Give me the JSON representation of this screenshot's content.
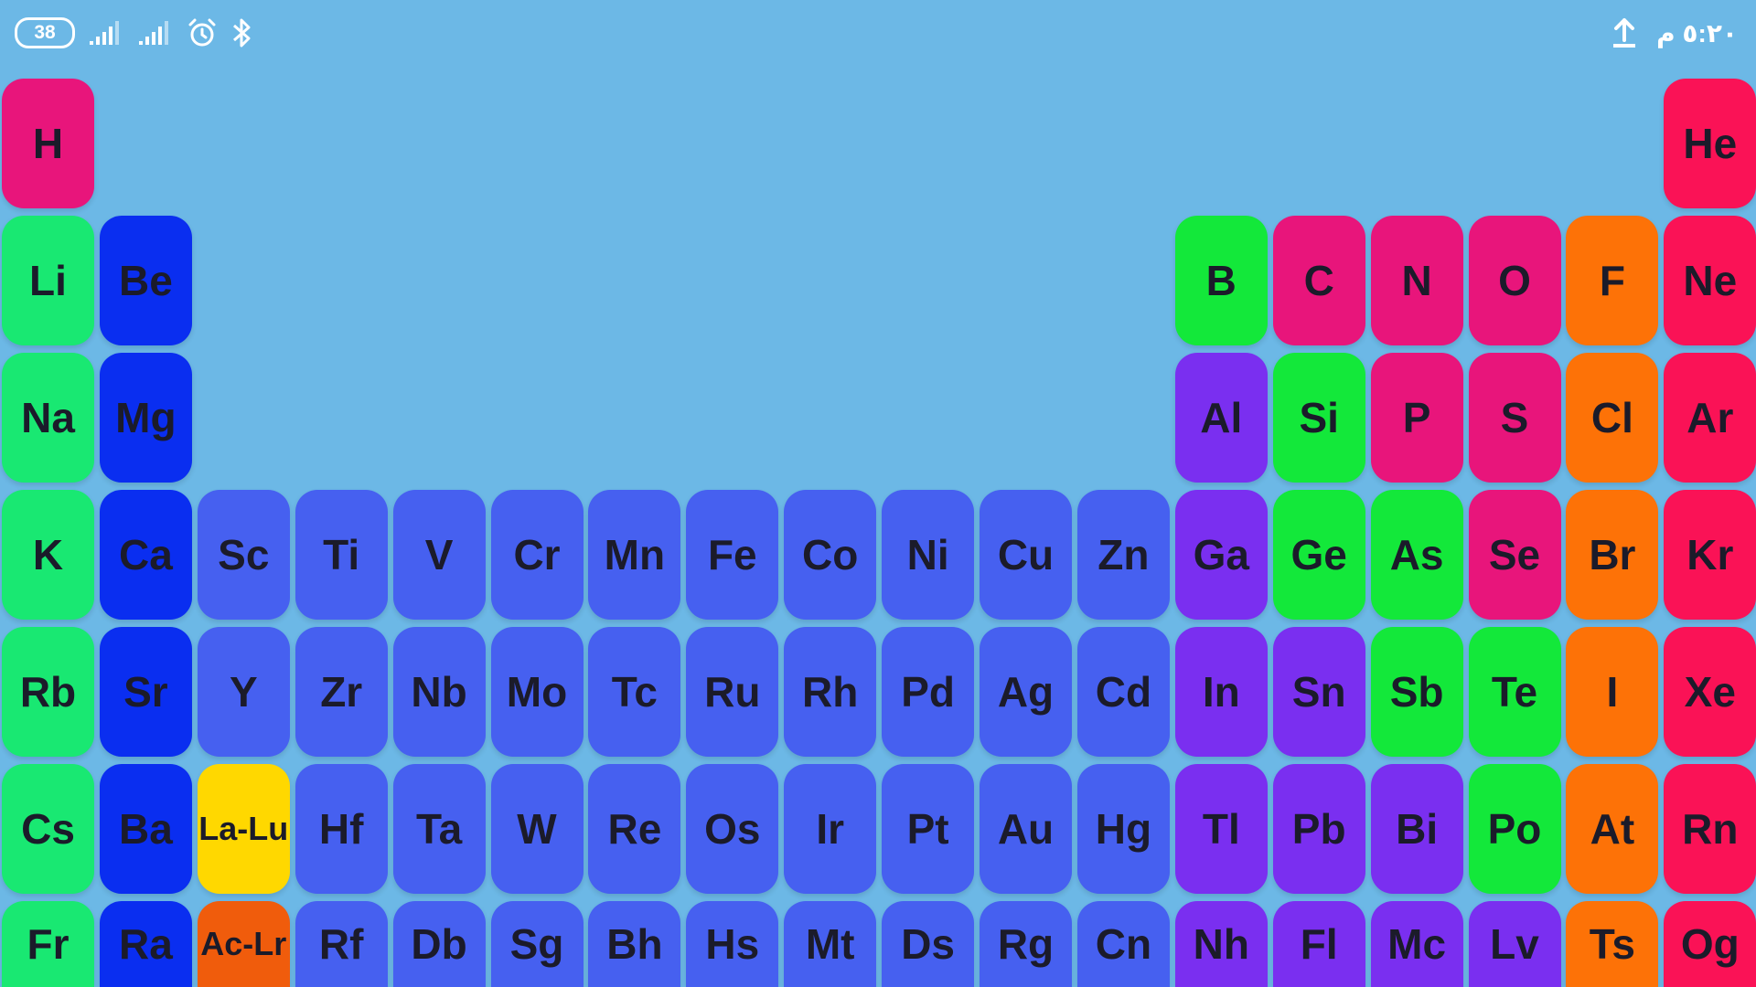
{
  "status_bar": {
    "battery": "38",
    "time": "٥:٢٠ م",
    "icons": [
      "signal-icon",
      "signal-icon",
      "alarm-icon",
      "bluetooth-icon",
      "upload-icon"
    ]
  },
  "colors": {
    "background": "#6cb8e6",
    "alkali_metal": "#19e872",
    "alkaline_earth": "#0a2ef0",
    "transition_metal": "#4660f0",
    "post_transition": "#7a2ff0",
    "metalloid": "#13e83a",
    "nonmetal": "#e8157b",
    "halogen": "#fd7207",
    "noble_gas": "#fa1256",
    "lanthanide": "#ffd800",
    "actinide": "#f05c0c"
  },
  "table": {
    "rows": [
      [
        {
          "s": "H",
          "t": "nonmetal"
        },
        {
          "s": "He",
          "t": "noble_gas"
        }
      ],
      [
        {
          "s": "Li",
          "t": "alkali_metal"
        },
        {
          "s": "Be",
          "t": "alkaline_earth"
        },
        {
          "s": "B",
          "t": "metalloid"
        },
        {
          "s": "C",
          "t": "nonmetal"
        },
        {
          "s": "N",
          "t": "nonmetal"
        },
        {
          "s": "O",
          "t": "nonmetal"
        },
        {
          "s": "F",
          "t": "halogen"
        },
        {
          "s": "Ne",
          "t": "noble_gas"
        }
      ],
      [
        {
          "s": "Na",
          "t": "alkali_metal"
        },
        {
          "s": "Mg",
          "t": "alkaline_earth"
        },
        {
          "s": "Al",
          "t": "post_transition"
        },
        {
          "s": "Si",
          "t": "metalloid"
        },
        {
          "s": "P",
          "t": "nonmetal"
        },
        {
          "s": "S",
          "t": "nonmetal"
        },
        {
          "s": "Cl",
          "t": "halogen"
        },
        {
          "s": "Ar",
          "t": "noble_gas"
        }
      ],
      [
        {
          "s": "K",
          "t": "alkali_metal"
        },
        {
          "s": "Ca",
          "t": "alkaline_earth"
        },
        {
          "s": "Sc",
          "t": "transition_metal"
        },
        {
          "s": "Ti",
          "t": "transition_metal"
        },
        {
          "s": "V",
          "t": "transition_metal"
        },
        {
          "s": "Cr",
          "t": "transition_metal"
        },
        {
          "s": "Mn",
          "t": "transition_metal"
        },
        {
          "s": "Fe",
          "t": "transition_metal"
        },
        {
          "s": "Co",
          "t": "transition_metal"
        },
        {
          "s": "Ni",
          "t": "transition_metal"
        },
        {
          "s": "Cu",
          "t": "transition_metal"
        },
        {
          "s": "Zn",
          "t": "transition_metal"
        },
        {
          "s": "Ga",
          "t": "post_transition"
        },
        {
          "s": "Ge",
          "t": "metalloid"
        },
        {
          "s": "As",
          "t": "metalloid"
        },
        {
          "s": "Se",
          "t": "nonmetal"
        },
        {
          "s": "Br",
          "t": "halogen"
        },
        {
          "s": "Kr",
          "t": "noble_gas"
        }
      ],
      [
        {
          "s": "Rb",
          "t": "alkali_metal"
        },
        {
          "s": "Sr",
          "t": "alkaline_earth"
        },
        {
          "s": "Y",
          "t": "transition_metal"
        },
        {
          "s": "Zr",
          "t": "transition_metal"
        },
        {
          "s": "Nb",
          "t": "transition_metal"
        },
        {
          "s": "Mo",
          "t": "transition_metal"
        },
        {
          "s": "Tc",
          "t": "transition_metal"
        },
        {
          "s": "Ru",
          "t": "transition_metal"
        },
        {
          "s": "Rh",
          "t": "transition_metal"
        },
        {
          "s": "Pd",
          "t": "transition_metal"
        },
        {
          "s": "Ag",
          "t": "transition_metal"
        },
        {
          "s": "Cd",
          "t": "transition_metal"
        },
        {
          "s": "In",
          "t": "post_transition"
        },
        {
          "s": "Sn",
          "t": "post_transition"
        },
        {
          "s": "Sb",
          "t": "metalloid"
        },
        {
          "s": "Te",
          "t": "metalloid"
        },
        {
          "s": "I",
          "t": "halogen"
        },
        {
          "s": "Xe",
          "t": "noble_gas"
        }
      ],
      [
        {
          "s": "Cs",
          "t": "alkali_metal"
        },
        {
          "s": "Ba",
          "t": "alkaline_earth"
        },
        {
          "s": "La-Lu",
          "t": "lanthanide"
        },
        {
          "s": "Hf",
          "t": "transition_metal"
        },
        {
          "s": "Ta",
          "t": "transition_metal"
        },
        {
          "s": "W",
          "t": "transition_metal"
        },
        {
          "s": "Re",
          "t": "transition_metal"
        },
        {
          "s": "Os",
          "t": "transition_metal"
        },
        {
          "s": "Ir",
          "t": "transition_metal"
        },
        {
          "s": "Pt",
          "t": "transition_metal"
        },
        {
          "s": "Au",
          "t": "transition_metal"
        },
        {
          "s": "Hg",
          "t": "transition_metal"
        },
        {
          "s": "Tl",
          "t": "post_transition"
        },
        {
          "s": "Pb",
          "t": "post_transition"
        },
        {
          "s": "Bi",
          "t": "post_transition"
        },
        {
          "s": "Po",
          "t": "metalloid"
        },
        {
          "s": "At",
          "t": "halogen"
        },
        {
          "s": "Rn",
          "t": "noble_gas"
        }
      ],
      [
        {
          "s": "Fr",
          "t": "alkali_metal"
        },
        {
          "s": "Ra",
          "t": "alkaline_earth"
        },
        {
          "s": "Ac-Lr",
          "t": "actinide"
        },
        {
          "s": "Rf",
          "t": "transition_metal"
        },
        {
          "s": "Db",
          "t": "transition_metal"
        },
        {
          "s": "Sg",
          "t": "transition_metal"
        },
        {
          "s": "Bh",
          "t": "transition_metal"
        },
        {
          "s": "Hs",
          "t": "transition_metal"
        },
        {
          "s": "Mt",
          "t": "transition_metal"
        },
        {
          "s": "Ds",
          "t": "transition_metal"
        },
        {
          "s": "Rg",
          "t": "transition_metal"
        },
        {
          "s": "Cn",
          "t": "transition_metal"
        },
        {
          "s": "Nh",
          "t": "post_transition"
        },
        {
          "s": "Fl",
          "t": "post_transition"
        },
        {
          "s": "Mc",
          "t": "post_transition"
        },
        {
          "s": "Lv",
          "t": "post_transition"
        },
        {
          "s": "Ts",
          "t": "halogen"
        },
        {
          "s": "Og",
          "t": "noble_gas"
        }
      ]
    ]
  }
}
